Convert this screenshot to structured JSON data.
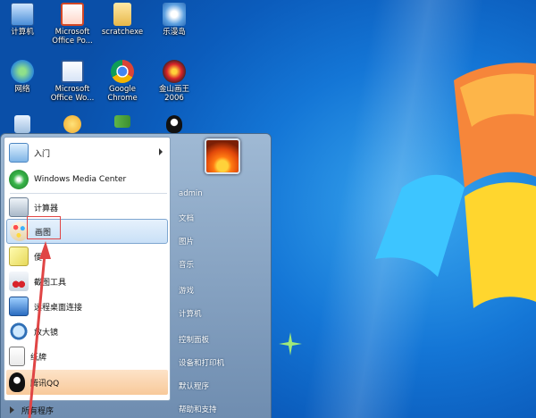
{
  "desktop": {
    "icons": [
      {
        "label": "计算机",
        "icon": "computer-icon"
      },
      {
        "label": "Microsoft\nOffice Po...",
        "icon": "powerpoint-icon"
      },
      {
        "label": "scratchexe",
        "icon": "folder-icon"
      },
      {
        "label": "乐漫岛",
        "icon": "app-icon"
      },
      {
        "label": "网络",
        "icon": "network-icon"
      },
      {
        "label": "Microsoft\nOffice Wo...",
        "icon": "word-icon"
      },
      {
        "label": "Google\nChrome",
        "icon": "chrome-icon"
      },
      {
        "label": "金山画王\n2006",
        "icon": "paint-king-icon"
      },
      {
        "label": "",
        "icon": "recycle-bin-icon"
      },
      {
        "label": "",
        "icon": "app-icon"
      },
      {
        "label": "",
        "icon": "flag-icon"
      },
      {
        "label": "",
        "icon": "penguin-icon"
      }
    ]
  },
  "start_menu": {
    "programs": [
      {
        "label": "入门",
        "icon": "getting-started-icon",
        "has_arrow": true
      },
      {
        "label": "Windows Media Center",
        "icon": "media-center-icon"
      },
      {
        "label": "计算器",
        "icon": "calculator-icon"
      },
      {
        "label": "画图",
        "icon": "paint-icon",
        "selected": true
      },
      {
        "label": "便",
        "icon": "sticky-notes-icon"
      },
      {
        "label": "截图工具",
        "icon": "snipping-tool-icon"
      },
      {
        "label": "远程桌面连接",
        "icon": "remote-desktop-icon"
      },
      {
        "label": "放大镜",
        "icon": "magnifier-icon"
      },
      {
        "label": "纸牌",
        "icon": "solitaire-icon"
      },
      {
        "label": "腾讯QQ",
        "icon": "qq-icon"
      }
    ],
    "all_programs": "所有程序",
    "right": [
      {
        "label": "admin"
      },
      {
        "label": "文档"
      },
      {
        "label": "图片"
      },
      {
        "label": "音乐"
      },
      {
        "label": "游戏"
      },
      {
        "label": "计算机"
      },
      {
        "label": "控制面板"
      },
      {
        "label": "设备和打印机"
      },
      {
        "label": "默认程序"
      },
      {
        "label": "帮助和支持"
      }
    ]
  },
  "colors": {
    "accent": "#1476d6",
    "annotation": "#e04545"
  }
}
